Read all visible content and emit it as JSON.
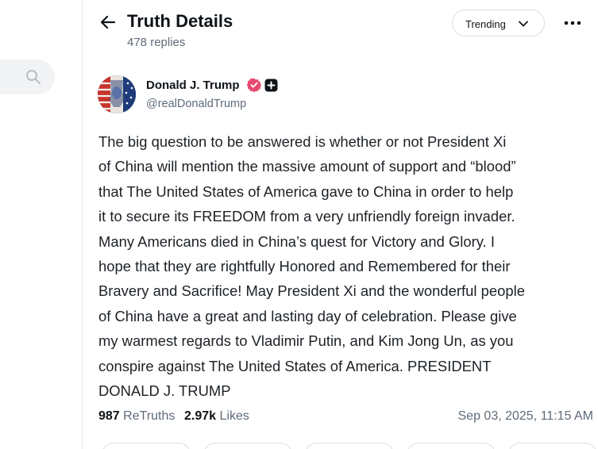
{
  "header": {
    "title": "Truth Details",
    "reply_count": "478 replies",
    "sort_label": "Trending"
  },
  "post": {
    "author_name": "Donald J. Trump",
    "handle": "@realDonaldTrump",
    "body": "The big question to be  answered is whether or not President Xi\nof China will mention the massive amount of  support and “blood”\nthat The United States of America gave to China in order to help\nit to secure its FREEDOM from a very unfriendly foreign invader.\nMany Americans died in China’s quest for Victory and Glory. I\nhope that they are rightfully Honored and Remembered for their\nBravery and Sacrifice! May President Xi and the wonderful people\nof China have a great and lasting day of celebration. Please give\nmy warmest regards to Vladimir Putin, and Kim Jong Un, as you\nconspire against The United States of America. PRESIDENT\nDONALD J. TRUMP",
    "retruths_count": "987",
    "retruths_label": "ReTruths",
    "likes_count": "2.97k",
    "likes_label": "Likes",
    "timestamp": "Sep 03, 2025, 11:15 AM"
  },
  "colors": {
    "accent_verified": "#e64a6f",
    "text_primary": "#0f1419",
    "text_secondary": "#606b78",
    "divider": "#e6e8eb"
  },
  "icons": [
    "search-icon",
    "back-arrow-icon",
    "chevron-down-icon",
    "more-icon",
    "verified-icon",
    "plus-badge-icon"
  ]
}
